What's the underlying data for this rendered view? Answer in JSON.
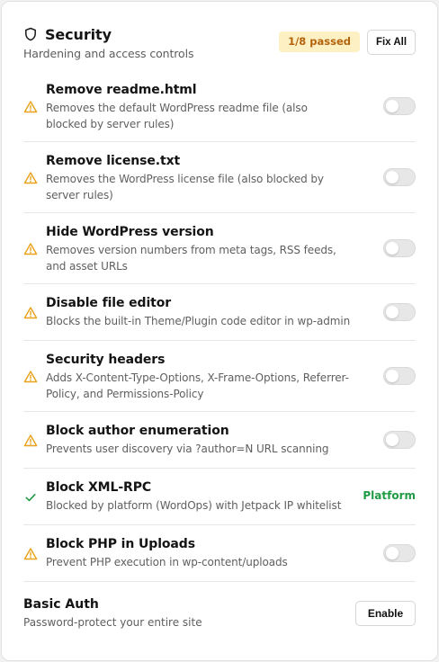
{
  "section": {
    "title": "Security",
    "subtitle": "Hardening and access controls",
    "badge": "1/8 passed",
    "fix_all_label": "Fix All"
  },
  "items": [
    {
      "label": "Remove readme.html",
      "desc": "Removes the default WordPress readme file (also blocked by server rules)",
      "status": "warning",
      "enabled": false
    },
    {
      "label": "Remove license.txt",
      "desc": "Removes the WordPress license file (also blocked by server rules)",
      "status": "warning",
      "enabled": false
    },
    {
      "label": "Hide WordPress version",
      "desc": "Removes version numbers from meta tags, RSS feeds, and asset URLs",
      "status": "warning",
      "enabled": false
    },
    {
      "label": "Disable file editor",
      "desc": "Blocks the built-in Theme/Plugin code editor in wp-admin",
      "status": "warning",
      "enabled": false
    },
    {
      "label": "Security headers",
      "desc": "Adds X-Content-Type-Options, X-Frame-Options, Referrer-Policy, and Permissions-Policy",
      "status": "warning",
      "enabled": false
    },
    {
      "label": "Block author enumeration",
      "desc": "Prevents user discovery via ?author=N URL scanning",
      "status": "warning",
      "enabled": false
    },
    {
      "label": "Block XML-RPC",
      "desc": "Blocked by platform (WordOps) with Jetpack IP whitelist",
      "status": "passed",
      "platform_label": "Platform"
    },
    {
      "label": "Block PHP in Uploads",
      "desc": "Prevent PHP execution in wp-content/uploads",
      "status": "warning",
      "enabled": false
    }
  ],
  "basic_auth": {
    "label": "Basic Auth",
    "desc": "Password-protect your entire site",
    "enable_label": "Enable"
  },
  "colors": {
    "warning": "#e9a21a",
    "passed": "#1f9a45",
    "badge_bg": "#fdf1c4",
    "badge_text": "#b4630d"
  }
}
